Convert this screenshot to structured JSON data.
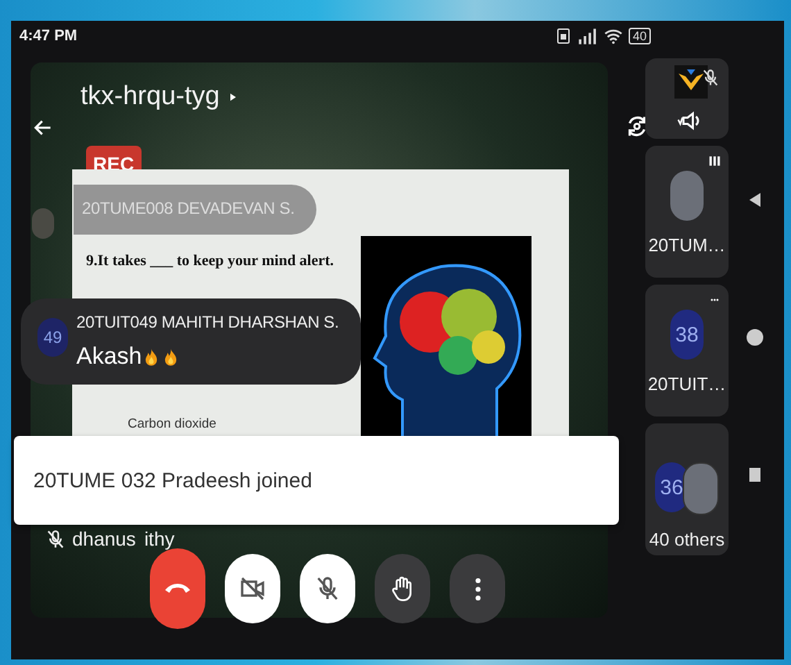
{
  "status_bar": {
    "time": "4:47 PM",
    "battery": "40"
  },
  "meeting": {
    "code": "tkx-hrqu-tyg",
    "recording_badge": "REC"
  },
  "slide": {
    "question": "9.It takes ___ to keep your mind alert.",
    "option": "Carbon dioxide"
  },
  "chat_messages": [
    {
      "sender": "20TUME008 DEVADEVAN S.",
      "kind": "photo"
    },
    {
      "sender": "20TUIT049 MAHITH DHARSHAN S.",
      "kind": "initials",
      "avatar_text": "49",
      "text": "Akash",
      "reactions": [
        {
          "kind": "flame"
        },
        {
          "kind": "flame"
        }
      ]
    }
  ],
  "toast": "20TUME 032 Pradeesh joined",
  "presenter": {
    "name_parts": [
      "dhanus",
      "ithy"
    ],
    "muted": true
  },
  "controls": [
    {
      "kind": "end_call"
    },
    {
      "kind": "camera",
      "on": false
    },
    {
      "kind": "mic",
      "on": false
    },
    {
      "kind": "raise_hand"
    },
    {
      "kind": "more"
    }
  ],
  "participants": [
    {
      "kind": "logo",
      "muted": true
    },
    {
      "name": "20TUM…",
      "kind": "photo",
      "speaking": true
    },
    {
      "name": "20TUIT…",
      "kind": "initials",
      "avatar_text": "38",
      "speaking": false
    },
    {
      "name": "40 others",
      "kind": "group",
      "avatar_text": "36"
    }
  ]
}
